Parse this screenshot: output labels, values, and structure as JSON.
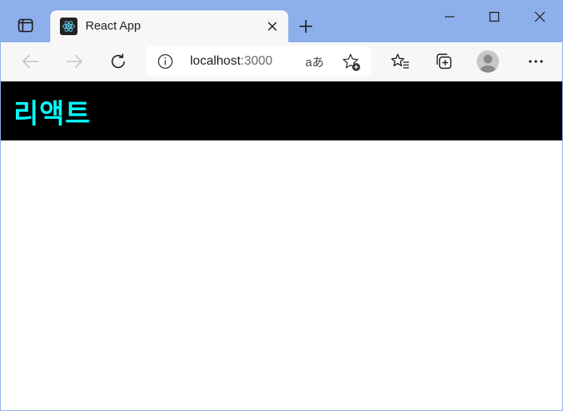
{
  "browser": {
    "tab": {
      "title": "React App"
    },
    "address": {
      "host": "localhost",
      "port": ":3000"
    },
    "read_aloud_glyph": "aあ"
  },
  "page": {
    "header_title": "리액트"
  },
  "colors": {
    "titlebar": "#8dafeb",
    "header_bg": "#000000",
    "header_text": "#00ffff"
  }
}
